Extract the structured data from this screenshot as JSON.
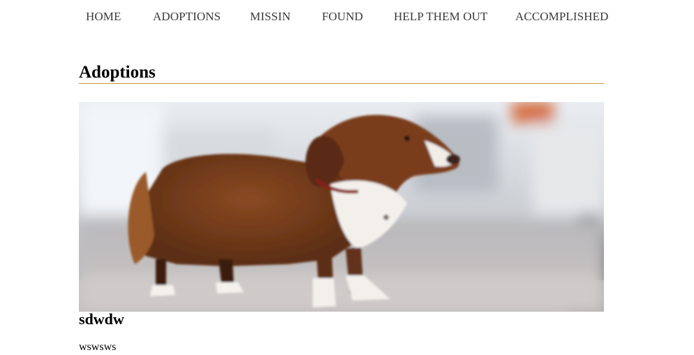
{
  "nav": {
    "items": [
      {
        "label": "HOME"
      },
      {
        "label": "ADOPTIONS"
      },
      {
        "label": "MISSIN"
      },
      {
        "label": "FOUND"
      },
      {
        "label": "HELP THEM OUT"
      },
      {
        "label": "ACCOMPLISHED"
      }
    ]
  },
  "main": {
    "title": "Adoptions",
    "accent_color": "#c49a2c",
    "listing": {
      "name": "sdwdw",
      "description": "wswsws"
    }
  }
}
